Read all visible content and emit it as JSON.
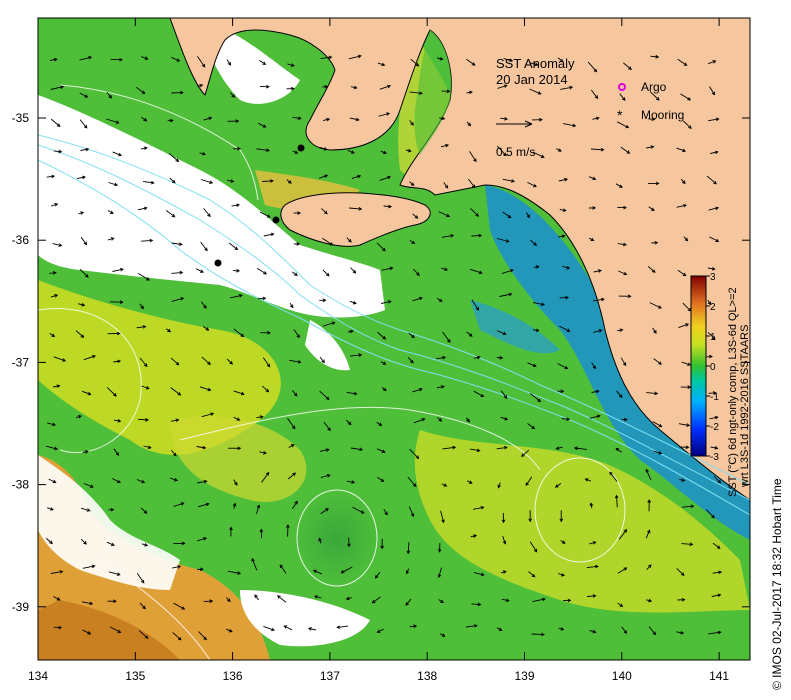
{
  "map": {
    "title": "SST Anomaly",
    "date": "20 Jan 2014",
    "scale_label": "0.5 m/s",
    "legend": [
      {
        "label": "Argo",
        "color": "#e000e0",
        "symbol": "circle-open"
      },
      {
        "label": "Mooring",
        "color": "#000000",
        "symbol": "asterisk"
      }
    ],
    "x_ticks": [
      "134",
      "135",
      "136",
      "137",
      "138",
      "139",
      "140",
      "141"
    ],
    "y_ticks": [
      "-35",
      "-36",
      "-37",
      "-38",
      "-39"
    ],
    "colorbar": {
      "ticks": [
        "3",
        "2",
        "1",
        "0",
        "-1",
        "-2",
        "-3"
      ],
      "label_line1": "SST (°C) 6d ngt-only comp, L3S-6d QL>=2",
      "label_line2": "wrt L3S-1d 1992-2016 SSTAARS"
    },
    "credit": "© IMOS 02-Jul-2017 18:32 Hobart Time",
    "colors": {
      "land": "#f6c79e",
      "ocean_green": "#4fbf3a",
      "anomaly_yellow": "#d8e020",
      "anomaly_orange": "#e4a030",
      "anomaly_cool": "#1a8fd0",
      "no_data": "#ffffff",
      "bathymetry_contour": "#7fe0f0"
    }
  }
}
